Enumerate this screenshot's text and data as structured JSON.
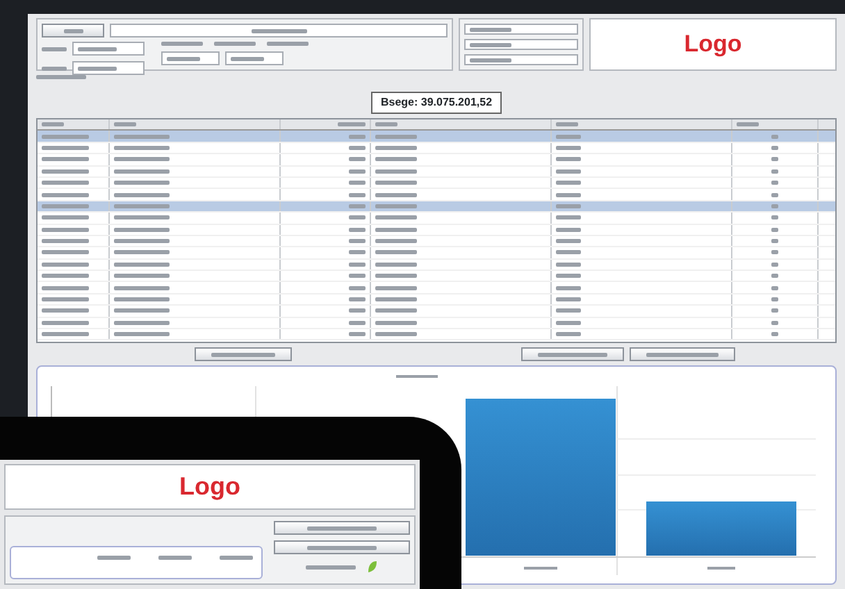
{
  "desktop": {
    "logo": "Logo",
    "balance": "Bsege: 39.075.201,52",
    "table": {
      "rows": [
        {
          "selected": true
        },
        {
          "selected": false
        },
        {
          "selected": false
        },
        {
          "selected": false
        },
        {
          "selected": false
        },
        {
          "selected": false
        },
        {
          "selected": true
        },
        {
          "selected": false
        },
        {
          "selected": false
        },
        {
          "selected": false
        },
        {
          "selected": false
        },
        {
          "selected": false
        },
        {
          "selected": false
        },
        {
          "selected": false
        },
        {
          "selected": false
        },
        {
          "selected": false
        },
        {
          "selected": false
        },
        {
          "selected": false
        }
      ]
    }
  },
  "tablet": {
    "logo": "Logo"
  }
}
